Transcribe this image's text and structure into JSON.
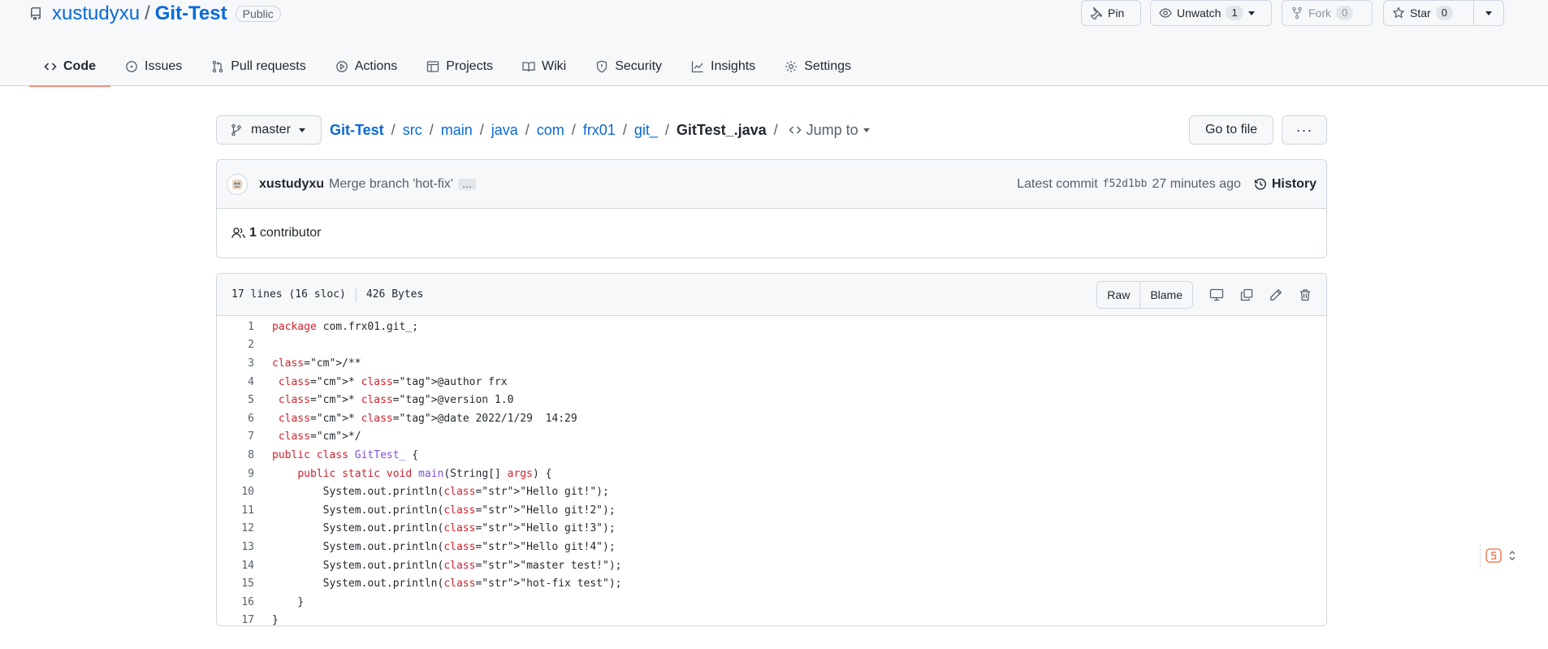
{
  "repo": {
    "owner": "xustudyxu",
    "separator": "/",
    "name": "Git-Test",
    "visibility": "Public"
  },
  "header_actions": {
    "pin_label": "Pin",
    "unwatch_label": "Unwatch",
    "watch_count": "1",
    "fork_label": "Fork",
    "fork_count": "0",
    "star_label": "Star",
    "star_count": "0"
  },
  "nav": {
    "tabs": [
      {
        "label": "Code",
        "icon": "code-icon",
        "selected": true
      },
      {
        "label": "Issues",
        "icon": "issue-icon"
      },
      {
        "label": "Pull requests",
        "icon": "pull-request-icon"
      },
      {
        "label": "Actions",
        "icon": "play-icon"
      },
      {
        "label": "Projects",
        "icon": "table-icon"
      },
      {
        "label": "Wiki",
        "icon": "book-icon"
      },
      {
        "label": "Security",
        "icon": "shield-icon"
      },
      {
        "label": "Insights",
        "icon": "graph-icon"
      },
      {
        "label": "Settings",
        "icon": "gear-icon"
      }
    ]
  },
  "branch": {
    "name": "master"
  },
  "breadcrumb": {
    "parts": [
      "Git-Test",
      "src",
      "main",
      "java",
      "com",
      "frx01",
      "git_"
    ],
    "sep": "/",
    "file": "GitTest_.java",
    "jump_label": "Jump to"
  },
  "file_actions": {
    "go_to_file": "Go to file",
    "more": "···"
  },
  "commit": {
    "author": "xustudyxu",
    "message": "Merge branch 'hot-fix'",
    "more": "…",
    "latest_label": "Latest commit",
    "sha": "f52d1bb",
    "time": "27 minutes ago",
    "history_label": "History"
  },
  "contributors": {
    "count": "1",
    "label": "contributor"
  },
  "file": {
    "lines_info": "17 lines (16 sloc)",
    "size": "426 Bytes",
    "raw_label": "Raw",
    "blame_label": "Blame",
    "code_lines": [
      {
        "n": "1",
        "text": "package com.frx01.git_;"
      },
      {
        "n": "2",
        "text": ""
      },
      {
        "n": "3",
        "text": "/**"
      },
      {
        "n": "4",
        "text": " * @author frx"
      },
      {
        "n": "5",
        "text": " * @version 1.0"
      },
      {
        "n": "6",
        "text": " * @date 2022/1/29  14:29"
      },
      {
        "n": "7",
        "text": " */"
      },
      {
        "n": "8",
        "text": "public class GitTest_ {"
      },
      {
        "n": "9",
        "text": "    public static void main(String[] args) {"
      },
      {
        "n": "10",
        "text": "        System.out.println(\"Hello git!\");"
      },
      {
        "n": "11",
        "text": "        System.out.println(\"Hello git!2\");"
      },
      {
        "n": "12",
        "text": "        System.out.println(\"Hello git!3\");"
      },
      {
        "n": "13",
        "text": "        System.out.println(\"Hello git!4\");"
      },
      {
        "n": "14",
        "text": "        System.out.println(\"master test!\");"
      },
      {
        "n": "15",
        "text": "        System.out.println(\"hot-fix test\");"
      },
      {
        "n": "16",
        "text": "    }"
      },
      {
        "n": "17",
        "text": "}"
      }
    ]
  },
  "colors": {
    "link": "#0969da",
    "tab_underline": "#fd8c73",
    "keyword": "#cf222e",
    "type": "#8250df"
  }
}
